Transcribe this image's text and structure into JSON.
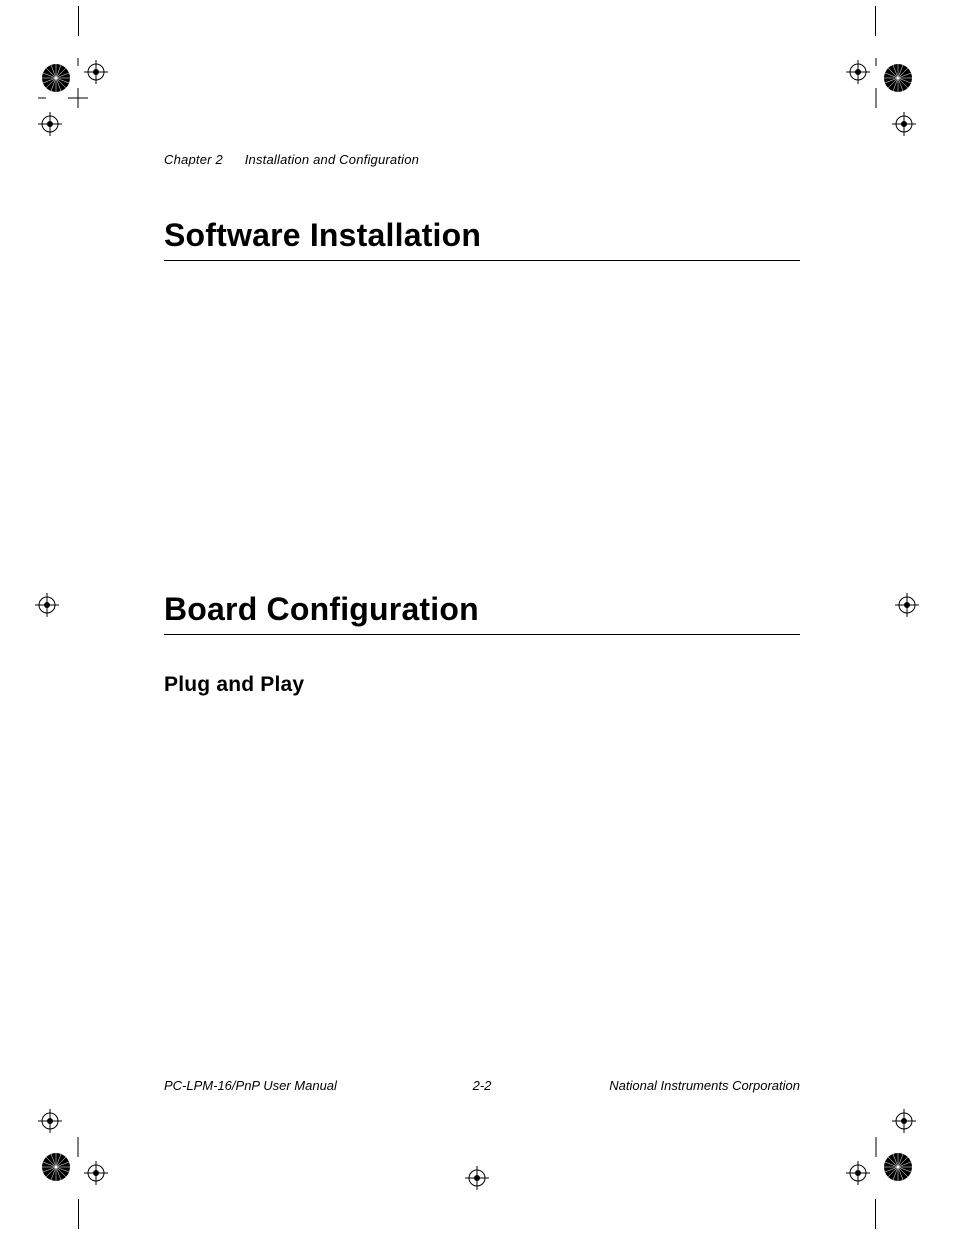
{
  "header": {
    "chapter_label": "Chapter 2",
    "chapter_title": "Installation and Configuration"
  },
  "sections": {
    "software_installation": "Software Installation",
    "board_configuration": "Board Configuration",
    "plug_and_play": "Plug and Play"
  },
  "footer": {
    "left": "PC-LPM-16/PnP User Manual",
    "center": "2-2",
    "right": "National Instruments Corporation"
  }
}
